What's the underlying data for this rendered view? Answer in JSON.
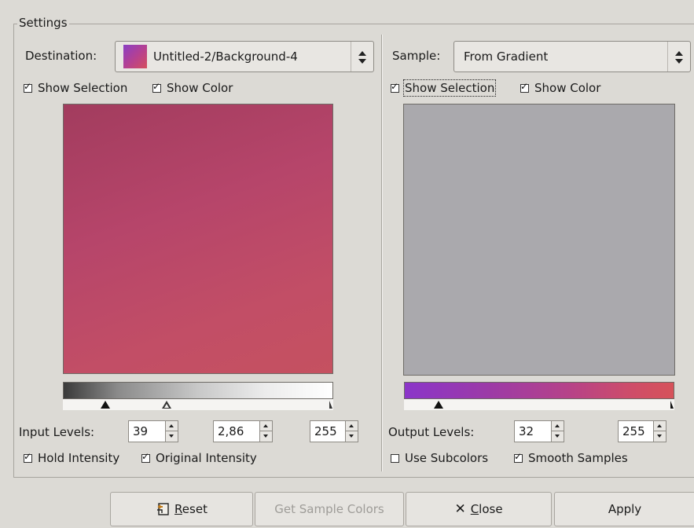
{
  "settings": {
    "frame_title": "Settings"
  },
  "left": {
    "destination_label": "Destination:",
    "destination_value": "Untitled-2/Background-4",
    "show_selection": "Show Selection",
    "show_color": "Show Color",
    "input_levels_label": "Input Levels:",
    "input_low": "39",
    "input_gamma": "2,86",
    "input_high": "255",
    "hold_intensity": "Hold Intensity",
    "original_intensity": "Original Intensity"
  },
  "right": {
    "sample_label": "Sample:",
    "sample_value": "From Gradient",
    "show_selection": "Show Selection",
    "show_color": "Show Color",
    "output_levels_label": "Output Levels:",
    "output_low": "32",
    "output_high": "255",
    "use_subcolors": "Use Subcolors",
    "smooth_samples": "Smooth Samples"
  },
  "buttons": {
    "reset_rest": "eset",
    "reset_mnemonic": "R",
    "get_sample_colors": "Get Sample Colors",
    "close_mnemonic": "C",
    "close_rest": "lose",
    "apply": "Apply"
  },
  "colors": {
    "background": "#dcdad5",
    "preview_left": "#b8456a",
    "preview_right": "#aaa9ad",
    "gradient_start": "#8b35c9",
    "gradient_end": "#d6525a"
  }
}
